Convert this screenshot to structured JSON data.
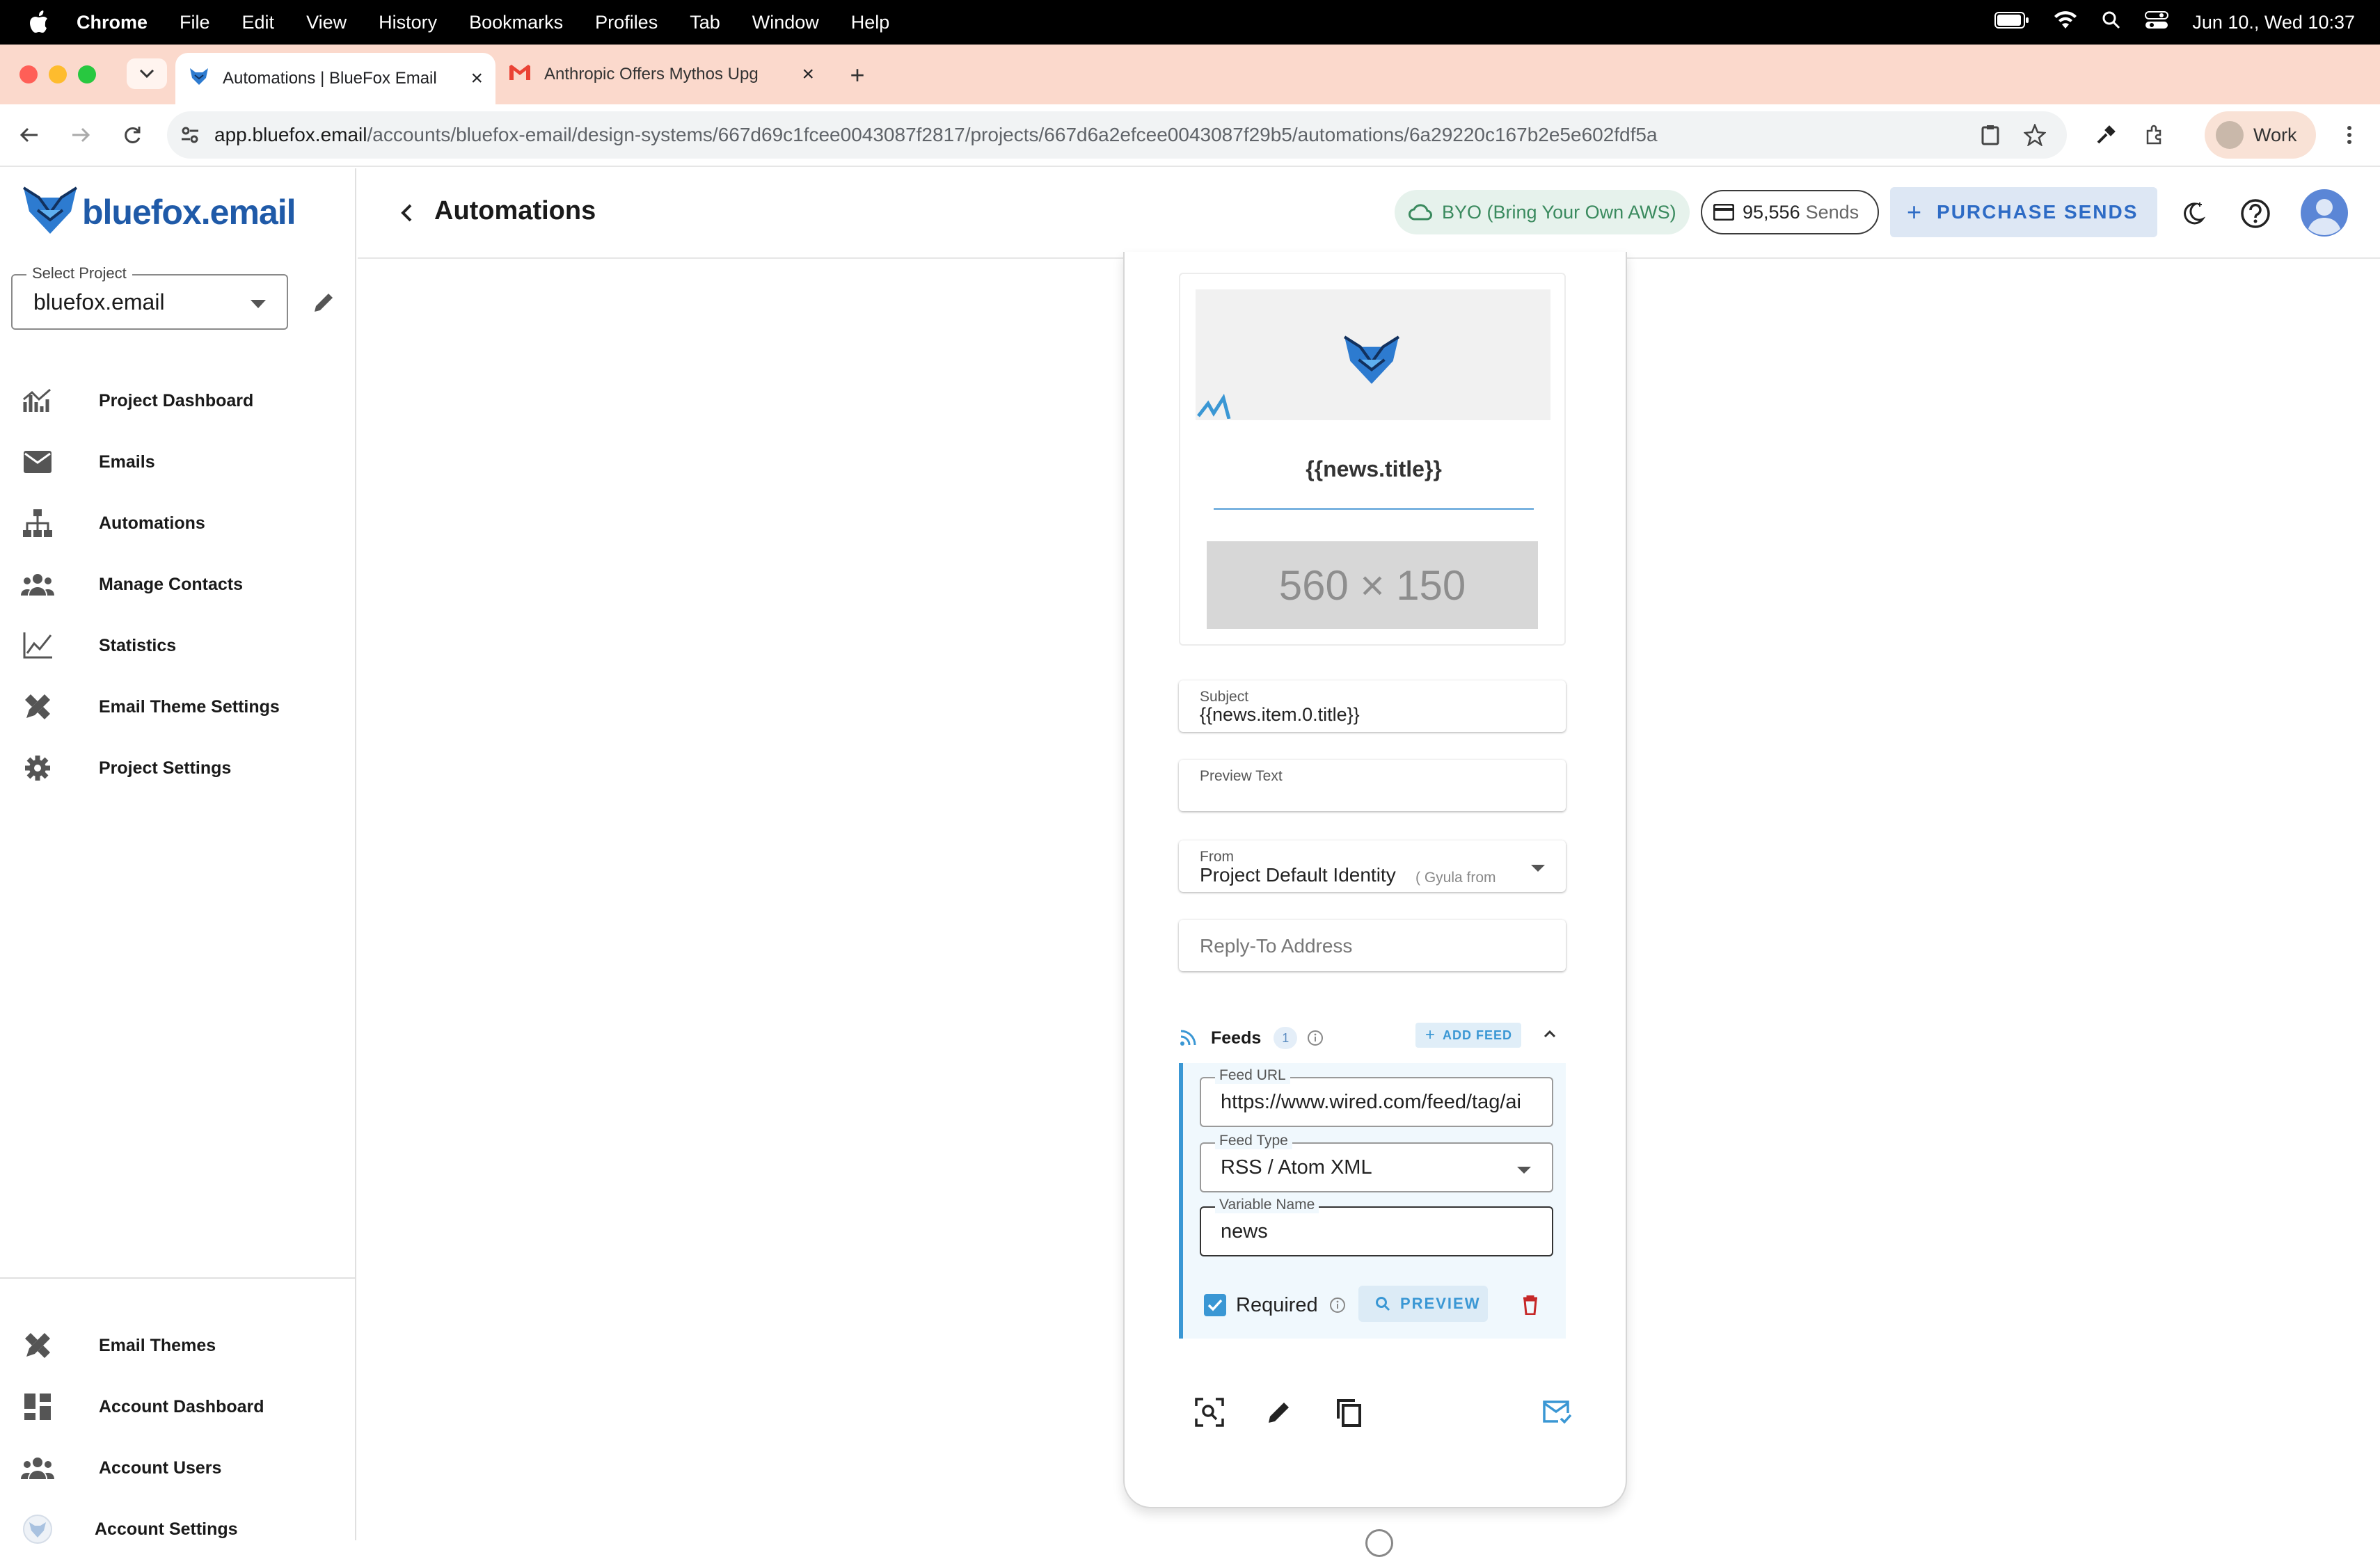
{
  "menubar": {
    "app": "Chrome",
    "items": [
      "File",
      "Edit",
      "View",
      "History",
      "Bookmarks",
      "Profiles",
      "Tab",
      "Window",
      "Help"
    ],
    "clock": "Jun 10., Wed  10:37"
  },
  "browser": {
    "tabs": [
      {
        "title": "Automations | BlueFox Email",
        "active": true
      },
      {
        "title": "Anthropic Offers Mythos Upg",
        "active": false
      }
    ],
    "url_host": "app.bluefox.email",
    "url_path": "/accounts/bluefox-email/design-systems/667d69c1fcee0043087f2817/projects/667d6a2efcee0043087f29b5/automations/6a29220c167b2e5e602fdf5a",
    "profile": "Work"
  },
  "app": {
    "logo": "bluefox.email",
    "project_select": {
      "label": "Select Project",
      "value": "bluefox.email"
    },
    "nav_top": [
      {
        "label": "Project Dashboard",
        "icon": "dashboard-chart-icon"
      },
      {
        "label": "Emails",
        "icon": "mail-icon"
      },
      {
        "label": "Automations",
        "icon": "sitemap-icon"
      },
      {
        "label": "Manage Contacts",
        "icon": "contacts-icon"
      },
      {
        "label": "Statistics",
        "icon": "line-chart-icon"
      },
      {
        "label": "Email Theme Settings",
        "icon": "design-tools-icon"
      },
      {
        "label": "Project Settings",
        "icon": "gear-icon"
      }
    ],
    "nav_bottom": [
      {
        "label": "Email Themes",
        "icon": "design-tools-icon"
      },
      {
        "label": "Account Dashboard",
        "icon": "dashboard-grid-icon"
      },
      {
        "label": "Account Users",
        "icon": "users-icon"
      },
      {
        "label": "Account Settings",
        "icon": "account-avatar-icon"
      }
    ],
    "header": {
      "title": "Automations",
      "byo": "BYO (Bring Your Own AWS)",
      "sends_count": "95,556",
      "sends_label": "Sends",
      "purchase": "PURCHASE SENDS"
    }
  },
  "email_node": {
    "news_title": "{{news.title}}",
    "placeholder": "560 × 150",
    "subject": {
      "label": "Subject",
      "value": "{{news.item.0.title}}"
    },
    "preview_text": {
      "label": "Preview Text",
      "value": ""
    },
    "from": {
      "label": "From",
      "value": "Project Default Identity",
      "hint": "( Gyula from"
    },
    "reply_to": {
      "placeholder": "Reply-To Address"
    },
    "feeds": {
      "label": "Feeds",
      "count": "1",
      "add_label": "ADD FEED",
      "feed_url": {
        "label": "Feed URL",
        "value": "https://www.wired.com/feed/tag/ai"
      },
      "feed_type": {
        "label": "Feed Type",
        "value": "RSS / Atom XML"
      },
      "variable_name": {
        "label": "Variable Name",
        "value": "news"
      },
      "required_label": "Required",
      "required_checked": true,
      "preview_label": "PREVIEW"
    }
  },
  "colors": {
    "accent": "#2d6bc5",
    "feed_accent": "#3a97d4",
    "byo_green": "#3a8a5e",
    "tabstrip": "#fbd9cc"
  }
}
